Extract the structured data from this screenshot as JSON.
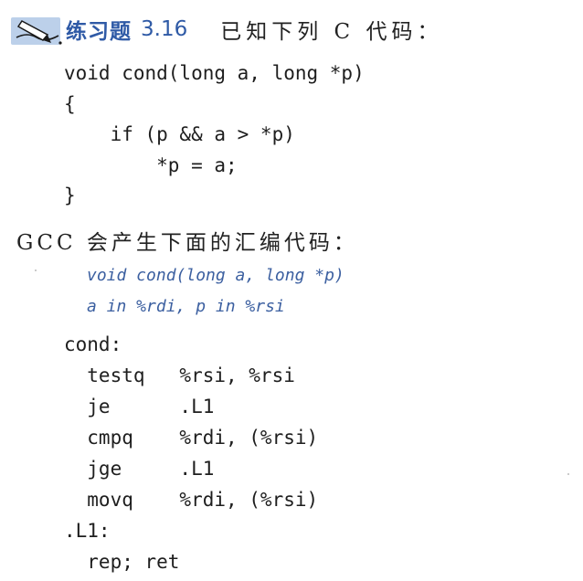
{
  "exercise": {
    "label": "练习题",
    "number": "3.16",
    "intro": "已知下列 C 代码："
  },
  "c_code": "void cond(long a, long *p)\n{\n    if (p && a > *p)\n        *p = a;\n}",
  "gcc_text": "GCC 会产生下面的汇编代码：",
  "asm_notes": [
    "void cond(long a, long *p)",
    "a in %rdi, p in %rsi"
  ],
  "asm_code": "cond:\n  testq   %rsi, %rsi\n  je      .L1\n  cmpq    %rdi, (%rsi)\n  jge     .L1\n  movq    %rdi, (%rsi)\n.L1:\n  rep; ret",
  "colors": {
    "accent": "#2f5aa6",
    "note": "#3b5fa0",
    "text": "#1a1a1a"
  },
  "icons": {
    "exercise_icon": "pen-writing-icon"
  }
}
